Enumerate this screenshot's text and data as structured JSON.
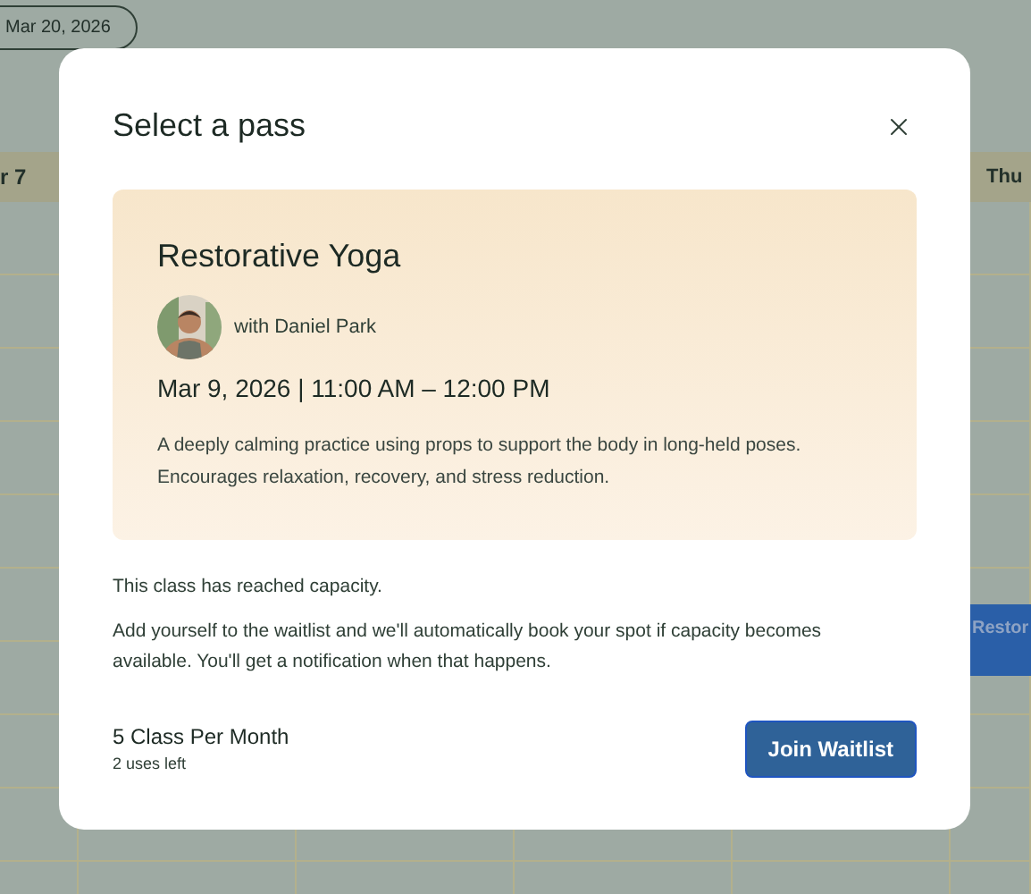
{
  "calendar": {
    "date_pill": "Mar 20, 2026",
    "day_headers": [
      "r 7",
      "Thu"
    ],
    "events": [
      {
        "title": "Restor"
      }
    ]
  },
  "dialog": {
    "title": "Select a pass",
    "class": {
      "name": "Restorative Yoga",
      "instructor": "with Daniel Park",
      "schedule": "Mar 9, 2026 | 11:00 AM – 12:00 PM",
      "description": "A deeply calming practice using props to support the body in long-held poses. Encourages relaxation, recovery, and stress reduction."
    },
    "notice": "This class has reached capacity.",
    "message": "Add yourself to the waitlist and we'll automatically book your spot if capacity becomes available. You'll get a notification when that happens.",
    "pass": {
      "name": "5 Class Per Month",
      "uses": "2 uses left"
    },
    "button": "Join Waitlist"
  }
}
